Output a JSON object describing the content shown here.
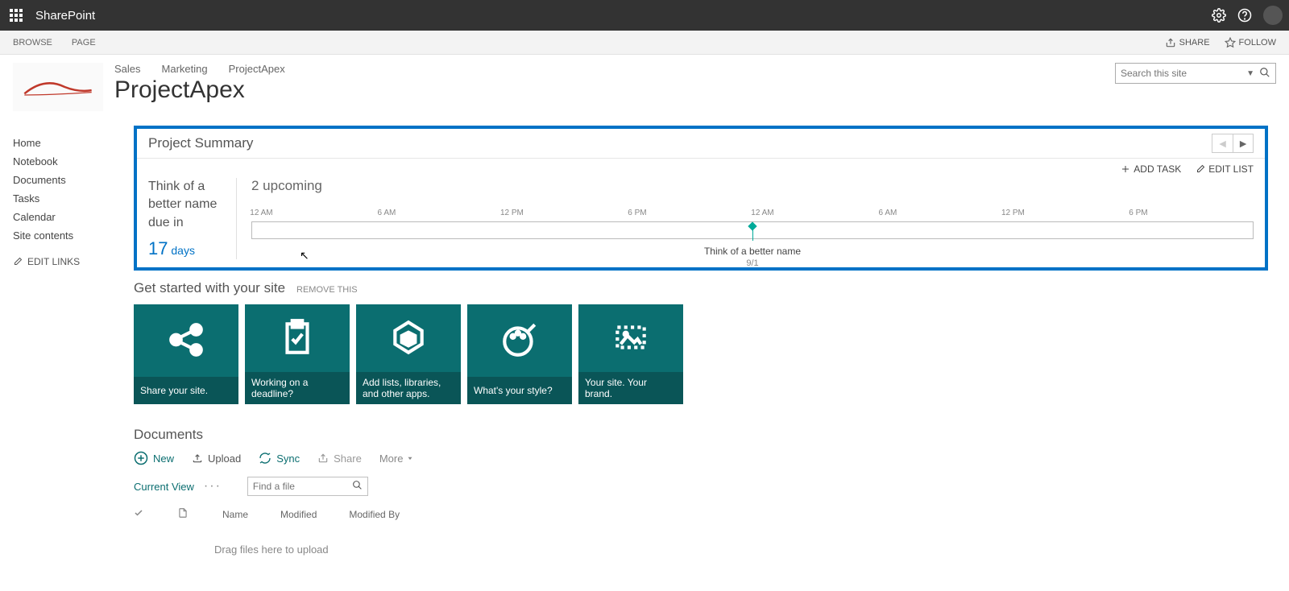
{
  "suite": {
    "brand": "SharePoint"
  },
  "ribbon": {
    "tabs": [
      "BROWSE",
      "PAGE"
    ],
    "share": "SHARE",
    "follow": "FOLLOW"
  },
  "breadcrumb": [
    "Sales",
    "Marketing",
    "ProjectApex"
  ],
  "page_title": "ProjectApex",
  "search": {
    "placeholder": "Search this site"
  },
  "left_nav": {
    "items": [
      "Home",
      "Notebook",
      "Documents",
      "Tasks",
      "Calendar",
      "Site contents"
    ],
    "edit_links": "EDIT LINKS"
  },
  "summary": {
    "title": "Project Summary",
    "add_task": "ADD TASK",
    "edit_list": "EDIT LIST",
    "task_name": "Think of a better name due in",
    "days_num": "17",
    "days_label": "days",
    "upcoming": "2 upcoming",
    "time_labels": [
      "12 AM",
      "6 AM",
      "12 PM",
      "6 PM",
      "12 AM",
      "6 AM",
      "12 PM",
      "6 PM"
    ],
    "marker": {
      "label": "Think of a better name",
      "date": "9/1"
    }
  },
  "get_started": {
    "title": "Get started with your site",
    "remove": "REMOVE THIS",
    "tiles": [
      "Share your site.",
      "Working on a deadline?",
      "Add lists, libraries, and other apps.",
      "What's your style?",
      "Your site. Your brand."
    ]
  },
  "documents": {
    "title": "Documents",
    "toolbar": {
      "new": "New",
      "upload": "Upload",
      "sync": "Sync",
      "share": "Share",
      "more": "More"
    },
    "current_view": "Current View",
    "find_placeholder": "Find a file",
    "columns": [
      "Name",
      "Modified",
      "Modified By"
    ],
    "drop_hint": "Drag files here to upload"
  }
}
